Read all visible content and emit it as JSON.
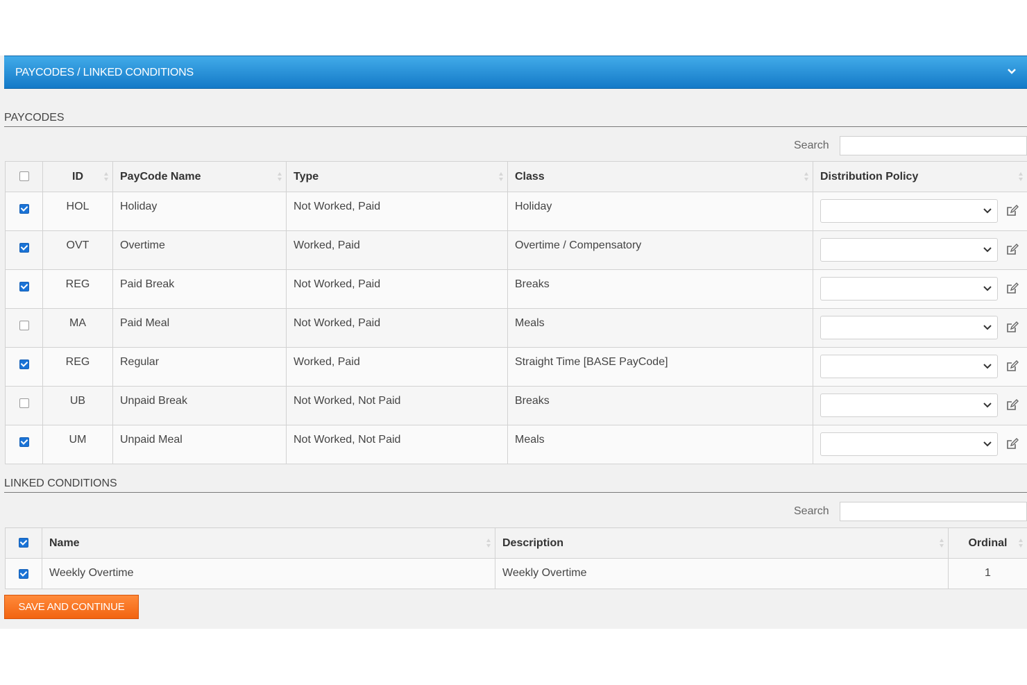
{
  "panel": {
    "title": "PAYCODES / LINKED CONDITIONS"
  },
  "paycodes": {
    "section_title": "PAYCODES",
    "search_label": "Search",
    "search_value": "",
    "columns": [
      "ID",
      "PayCode Name",
      "Type",
      "Class",
      "Distribution Policy"
    ],
    "rows": [
      {
        "checked": true,
        "id": "HOL",
        "name": "Holiday",
        "type": "Not Worked, Paid",
        "class": "Holiday",
        "policy": ""
      },
      {
        "checked": true,
        "id": "OVT",
        "name": "Overtime",
        "type": "Worked, Paid",
        "class": "Overtime / Compensatory",
        "policy": ""
      },
      {
        "checked": true,
        "id": "REG",
        "name": "Paid Break",
        "type": "Not Worked, Paid",
        "class": "Breaks",
        "policy": ""
      },
      {
        "checked": false,
        "id": "MA",
        "name": "Paid Meal",
        "type": "Not Worked, Paid",
        "class": "Meals",
        "policy": ""
      },
      {
        "checked": true,
        "id": "REG",
        "name": "Regular",
        "type": "Worked, Paid",
        "class": "Straight Time [BASE PayCode]",
        "policy": ""
      },
      {
        "checked": false,
        "id": "UB",
        "name": "Unpaid Break",
        "type": "Not Worked, Not Paid",
        "class": "Breaks",
        "policy": ""
      },
      {
        "checked": true,
        "id": "UM",
        "name": "Unpaid Meal",
        "type": "Not Worked, Not Paid",
        "class": "Meals",
        "policy": ""
      }
    ]
  },
  "linked": {
    "section_title": "LINKED CONDITIONS",
    "search_label": "Search",
    "search_value": "",
    "columns": [
      "Name",
      "Description",
      "Ordinal"
    ],
    "rows": [
      {
        "checked": true,
        "name": "Weekly Overtime",
        "description": "Weekly Overtime",
        "ordinal": "1"
      }
    ]
  },
  "actions": {
    "save_label": "SAVE AND CONTINUE"
  },
  "colors": {
    "header_blue": "#1479c7",
    "save_orange": "#f26411",
    "checkbox_blue": "#1a73d6"
  }
}
